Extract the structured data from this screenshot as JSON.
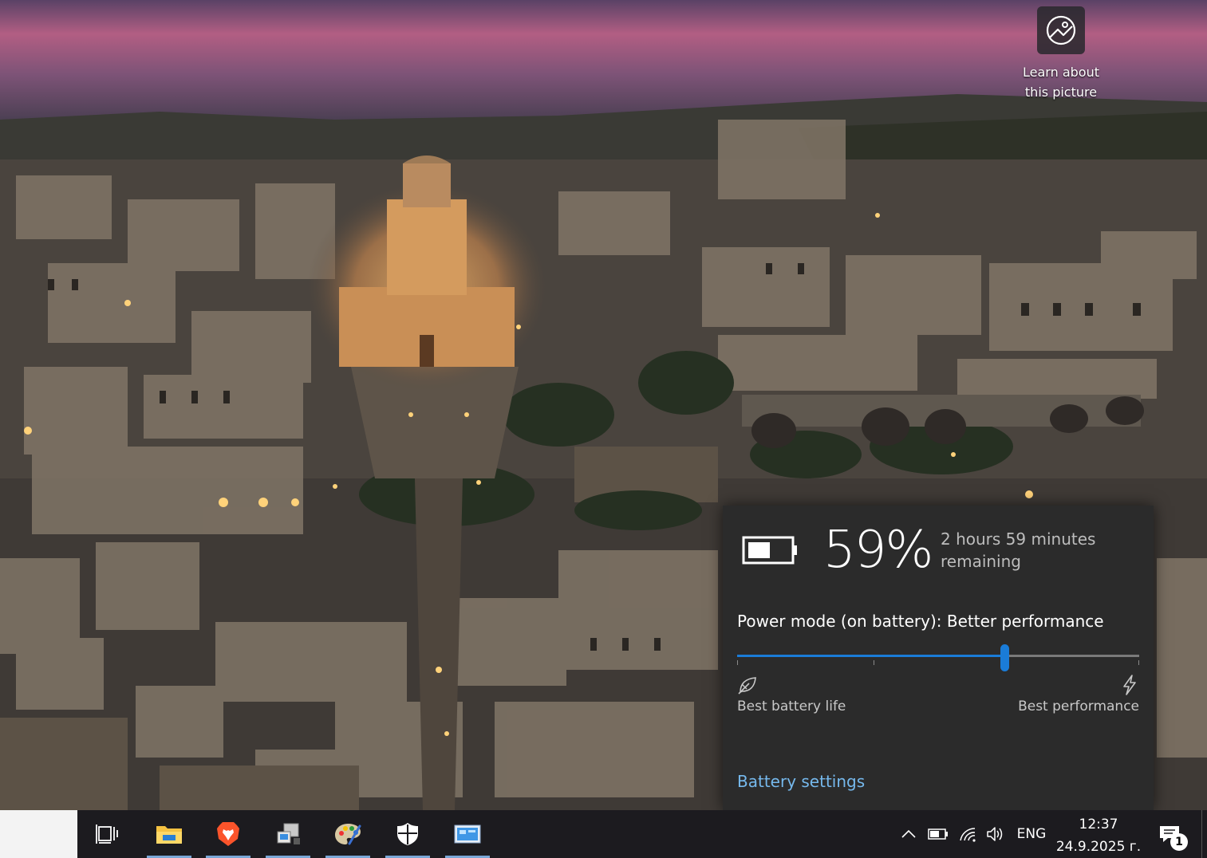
{
  "desktop": {
    "wallpaper_icon": "wallpaper-landscape",
    "learn_widget": {
      "icon": "camera-globe-icon",
      "label": "Learn about\nthis picture"
    }
  },
  "battery_flyout": {
    "battery_icon": "battery-icon",
    "percent": "59%",
    "percent_value": 59,
    "remaining": "2 hours 59 minutes remaining",
    "power_mode_text": "Power mode (on battery): Better performance",
    "slider": {
      "value_fraction": 0.665,
      "tick_fractions": [
        0.0,
        0.34,
        1.0
      ],
      "min_label": "Best battery life",
      "max_label": "Best performance",
      "min_icon": "battery-saver-leaf-icon",
      "max_icon": "lightning-bolt-icon"
    },
    "settings_link": "Battery settings",
    "accent_color": "#1a7cd8",
    "link_color": "#76b9ed"
  },
  "taskbar": {
    "apps": [
      {
        "name": "task-view",
        "icon": "task-view-icon",
        "running": false
      },
      {
        "name": "file-explorer",
        "icon": "folder-icon",
        "running": true
      },
      {
        "name": "brave",
        "icon": "brave-lion-icon",
        "running": true
      },
      {
        "name": "network-app",
        "icon": "network-computer-icon",
        "running": true
      },
      {
        "name": "paint",
        "icon": "palette-icon",
        "running": true
      },
      {
        "name": "security",
        "icon": "shield-icon",
        "running": true
      },
      {
        "name": "control-panel",
        "icon": "control-panel-icon",
        "running": true
      }
    ],
    "tray": {
      "show_hidden": "chevron-up-icon",
      "battery": "battery-icon",
      "wifi": "wifi-icon",
      "volume": "speaker-icon",
      "language": "ENG",
      "time": "12:37",
      "date": "24.9.2025 г.",
      "notifications_icon": "notification-icon",
      "notification_count": "1"
    }
  }
}
